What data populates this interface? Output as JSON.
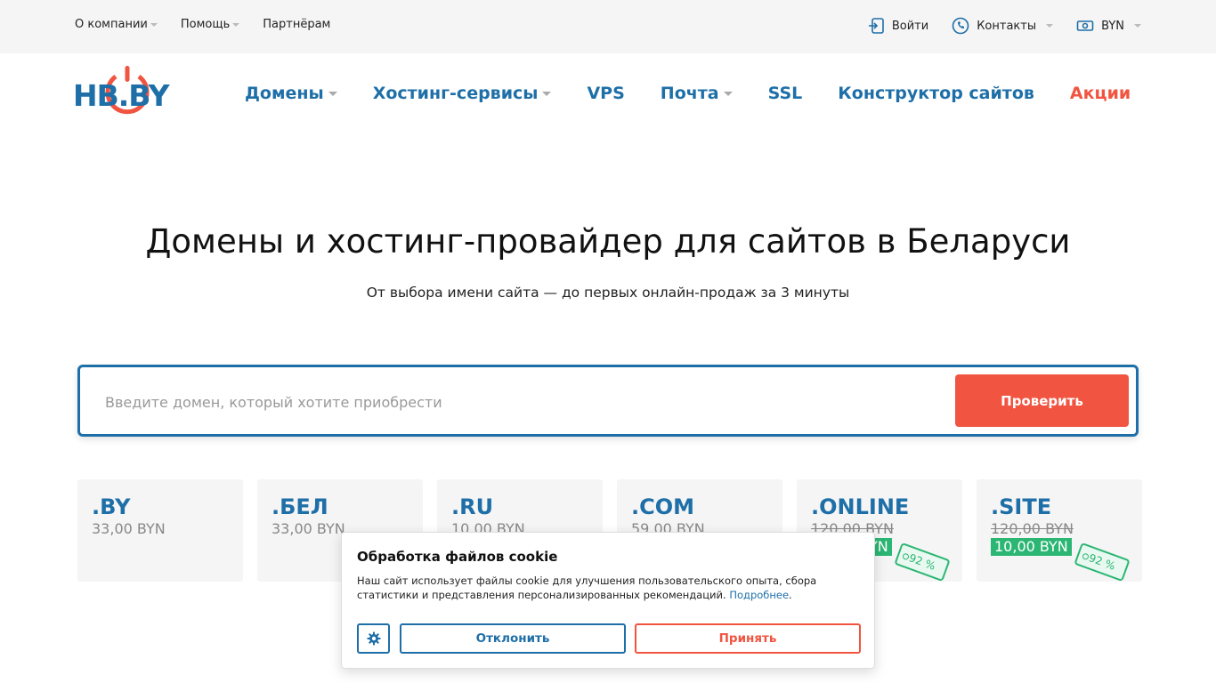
{
  "topbar": {
    "links": [
      {
        "label": "О компании",
        "dropdown": true
      },
      {
        "label": "Помощь",
        "dropdown": true
      },
      {
        "label": "Партнёрам",
        "dropdown": false
      }
    ],
    "login": "Войти",
    "contacts": "Контакты",
    "currency": "BYN"
  },
  "logo": {
    "text": "HB.BY"
  },
  "nav": {
    "items": [
      {
        "label": "Домены",
        "dropdown": true
      },
      {
        "label": "Хостинг-сервисы",
        "dropdown": true
      },
      {
        "label": "VPS",
        "dropdown": false
      },
      {
        "label": "Почта",
        "dropdown": true
      },
      {
        "label": "SSL",
        "dropdown": false
      },
      {
        "label": "Конструктор сайтов",
        "dropdown": false
      },
      {
        "label": "Акции",
        "dropdown": false
      }
    ]
  },
  "hero": {
    "title": "Домены и хостинг-провайдер для сайтов в Беларуси",
    "subtitle": "От выбора имени сайта — до первых онлайн-продаж за 3 минуты"
  },
  "search": {
    "placeholder": "Введите домен, который хотите приобрести",
    "button": "Проверить"
  },
  "zones": [
    {
      "name": ".BY",
      "price": "33,00 BYN"
    },
    {
      "name": ".БЕЛ",
      "price": "33,00 BYN"
    },
    {
      "name": ".RU",
      "price": "10,00 BYN"
    },
    {
      "name": ".COM",
      "price": "59,00 BYN"
    },
    {
      "name": ".ONLINE",
      "old_price": "120,00 BYN",
      "new_price": "10,00 BYN",
      "discount": "92 %"
    },
    {
      "name": ".SITE",
      "old_price": "120,00 BYN",
      "new_price": "10,00 BYN",
      "discount": "92 %"
    }
  ],
  "cookie": {
    "title": "Обработка файлов cookie",
    "text": "Наш сайт использует файлы cookie для улучшения пользовательского опыта, сбора статистики и представления персонализированных рекомендаций.",
    "more_link": "Подробнее",
    "decline": "Отклонить",
    "accept": "Принять"
  },
  "colors": {
    "brand_blue": "#1e6fa8",
    "accent_red": "#f15440",
    "discount_green": "#2bb673"
  }
}
